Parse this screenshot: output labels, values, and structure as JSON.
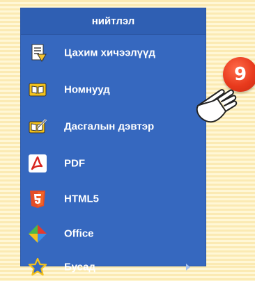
{
  "menu": {
    "header": "нийтлэл",
    "items": [
      {
        "label": "Цахим хичээлүүд",
        "icon": "e-lesson-icon"
      },
      {
        "label": "Номнууд",
        "icon": "book-icon"
      },
      {
        "label": "Дасгалын дэвтэр",
        "icon": "workbook-icon"
      },
      {
        "label": "PDF",
        "icon": "pdf-icon"
      },
      {
        "label": "HTML5",
        "icon": "html5-icon"
      },
      {
        "label": "Office",
        "icon": "office-icon"
      },
      {
        "label": "Бусад",
        "icon": "star-icon",
        "has_submenu": true
      }
    ]
  },
  "callout": {
    "step_number": "9",
    "pointer_icon": "pointing-hand-icon"
  },
  "colors": {
    "menu_bg": "#3668bf",
    "header_bg": "#2f5fb3",
    "badge": "#e83a1d",
    "page_bg": "#fbeab3"
  }
}
